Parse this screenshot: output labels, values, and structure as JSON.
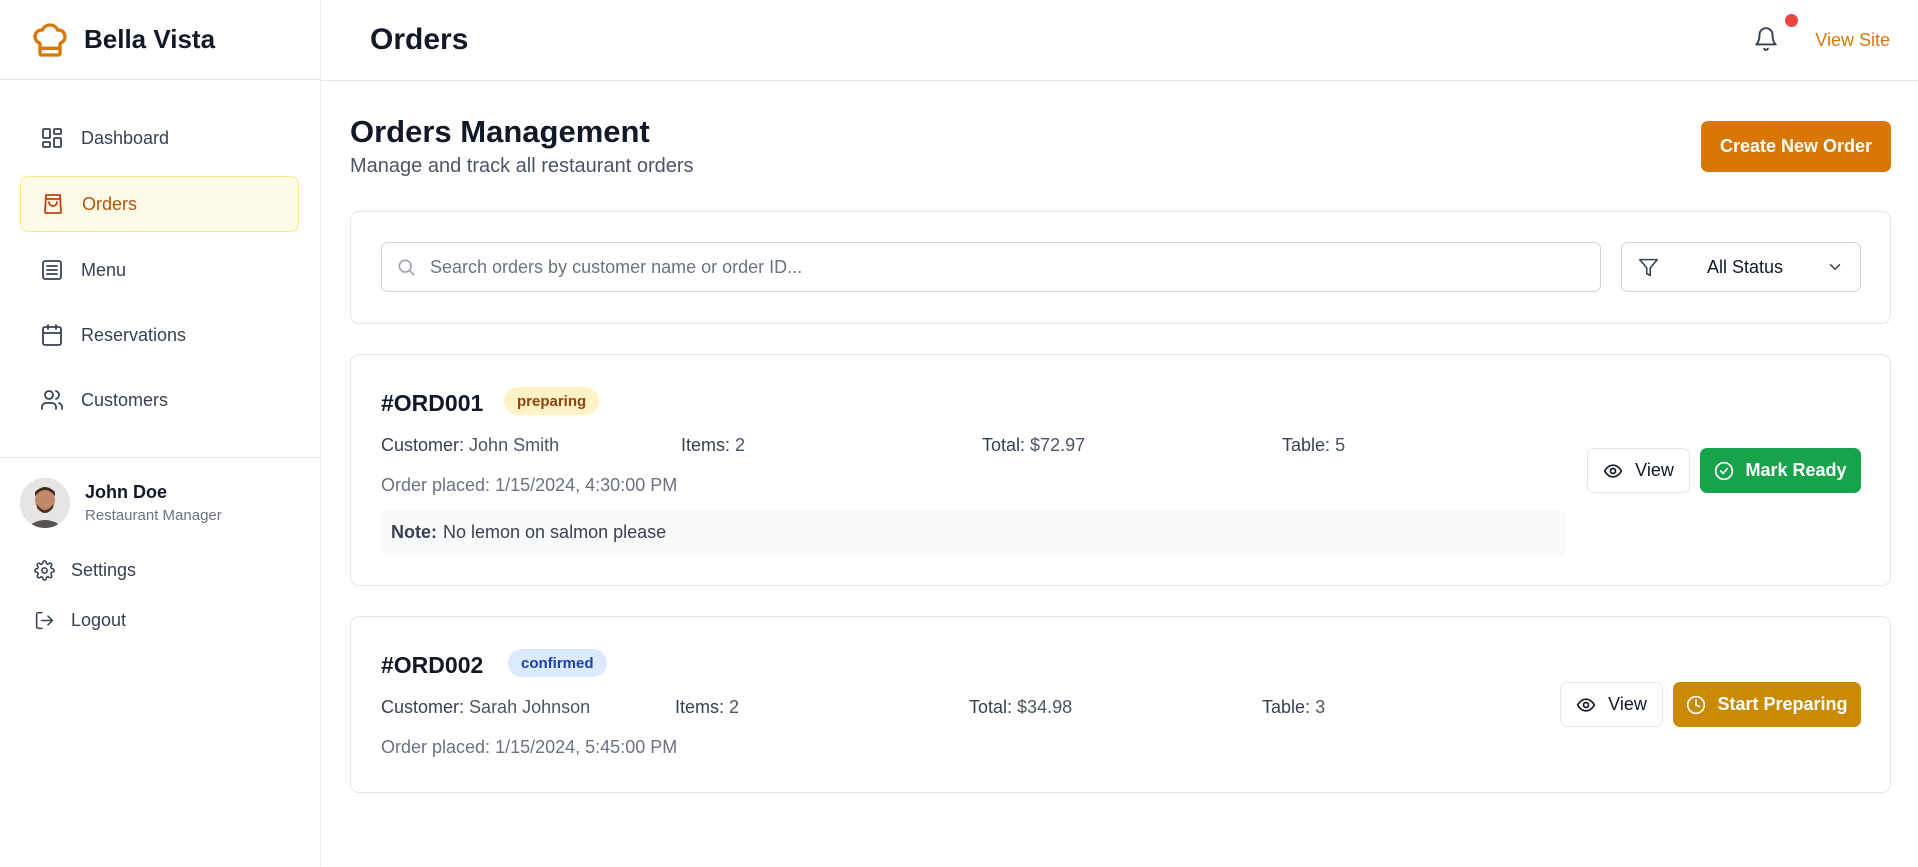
{
  "sidebar": {
    "brand": "Bella Vista",
    "nav": [
      {
        "label": "Dashboard",
        "icon": "dashboard-icon"
      },
      {
        "label": "Orders",
        "icon": "shopping-bag-icon",
        "active": true
      },
      {
        "label": "Menu",
        "icon": "menu-list-icon"
      },
      {
        "label": "Reservations",
        "icon": "calendar-icon"
      },
      {
        "label": "Customers",
        "icon": "users-icon"
      }
    ],
    "user": {
      "name": "John Doe",
      "role": "Restaurant Manager"
    },
    "settings_label": "Settings",
    "logout_label": "Logout"
  },
  "header": {
    "title": "Orders",
    "view_site": "View Site"
  },
  "page": {
    "title": "Orders Management",
    "subtitle": "Manage and track all restaurant orders",
    "create_button": "Create New Order"
  },
  "filters": {
    "search_placeholder": "Search orders by customer name or order ID...",
    "search_value": "",
    "status_selected": "All Status"
  },
  "orders": [
    {
      "id": "#ORD001",
      "status": "preparing",
      "customer_label": "Customer:",
      "customer": "John Smith",
      "items_label": "Items:",
      "items": "2",
      "total_label": "Total:",
      "total": "$72.97",
      "table_label": "Table:",
      "table": "5",
      "placed_label": "Order placed:",
      "placed": "1/15/2024, 4:30:00 PM",
      "note_label": "Note:",
      "note": "No lemon on salmon please",
      "view_label": "View",
      "action_label": "Mark Ready"
    },
    {
      "id": "#ORD002",
      "status": "confirmed",
      "customer_label": "Customer:",
      "customer": "Sarah Johnson",
      "items_label": "Items:",
      "items": "2",
      "total_label": "Total:",
      "total": "$34.98",
      "table_label": "Table:",
      "table": "3",
      "placed_label": "Order placed:",
      "placed": "1/15/2024, 5:45:00 PM",
      "view_label": "View",
      "action_label": "Start Preparing"
    }
  ],
  "colors": {
    "accent": "#d97706",
    "success": "#16a34a",
    "warning": "#ca8a04",
    "notification": "#ef4444"
  }
}
